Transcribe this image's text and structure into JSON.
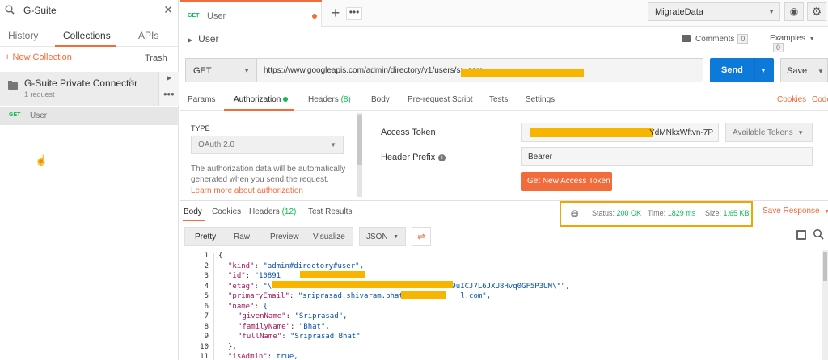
{
  "sidebar": {
    "search_value": "G-Suite",
    "tabs": [
      "History",
      "Collections",
      "APIs"
    ],
    "new_collection": "+ New Collection",
    "trash": "Trash",
    "collection": {
      "name": "G-Suite Private Connector",
      "count": "1 request"
    },
    "request": {
      "method": "GET",
      "name": "User"
    }
  },
  "tabbar": {
    "tab_method": "GET",
    "tab_name": "User",
    "plus": "+",
    "more": "•••",
    "environment": "MigrateData"
  },
  "request": {
    "title": "User",
    "comments_label": "Comments",
    "comments_count": "0",
    "examples_label": "Examples",
    "examples_count": "0",
    "method": "GET",
    "url": "https://www.googleapis.com/admin/directory/v1/users/sr                                          .com",
    "send": "Send",
    "save": "Save"
  },
  "req_tabs": {
    "params": "Params",
    "authorization": "Authorization",
    "headers": "Headers",
    "headers_count": "(8)",
    "body": "Body",
    "prerequest": "Pre-request Script",
    "tests": "Tests",
    "settings": "Settings",
    "cookies": "Cookies",
    "code": "Code"
  },
  "auth": {
    "type_label": "TYPE",
    "type_value": "OAuth 2.0",
    "description": "The authorization data will be automatically generated when you send the request.",
    "learn_more": "Learn more about authorization",
    "access_token_label": "Access Token",
    "access_token_value": "YdMNkxWftvn-7P",
    "available_tokens": "Available Tokens",
    "header_prefix_label": "Header Prefix",
    "header_prefix_value": "Bearer",
    "get_new_token": "Get New Access Token"
  },
  "response": {
    "tabs": {
      "body": "Body",
      "cookies": "Cookies",
      "headers": "Headers",
      "headers_count": "(12)",
      "test_results": "Test Results"
    },
    "status_label": "Status:",
    "status_value": "200 OK",
    "time_label": "Time:",
    "time_value": "1829 ms",
    "size_label": "Size:",
    "size_value": "1.65 KB",
    "save_response": "Save Response",
    "view_modes": [
      "Pretty",
      "Raw",
      "Preview",
      "Visualize"
    ],
    "format": "JSON"
  },
  "code_lines": [
    {
      "n": "1",
      "k": "",
      "v": "{"
    },
    {
      "n": "2",
      "k": "\"kind\"",
      "v": "\"admin#directory#user\","
    },
    {
      "n": "3",
      "k": "\"id\"",
      "v": "\"10891                \","
    },
    {
      "n": "4",
      "k": "\"etag\"",
      "v": "\"\\\"                                     vmM9uICJ7L6JXU8Hvq0GF5P3UM\\\"\","
    },
    {
      "n": "5",
      "k": "\"primaryEmail\"",
      "v": "\"sriprasad.shivaram.bhat@s           l.com\","
    },
    {
      "n": "6",
      "k": "\"name\"",
      "v": "{"
    },
    {
      "n": "7",
      "k": "\"givenName\"",
      "v": "\"Sriprasad\","
    },
    {
      "n": "8",
      "k": "\"familyName\"",
      "v": "\"Bhat\","
    },
    {
      "n": "9",
      "k": "\"fullName\"",
      "v": "\"Sriprasad Bhat\""
    },
    {
      "n": "10",
      "k": "",
      "v": "},"
    },
    {
      "n": "11",
      "k": "\"isAdmin\"",
      "v": "true,"
    }
  ],
  "colors": {
    "accent": "#f26b3a",
    "send_blue": "#0d7ad9",
    "green": "#0cbb52",
    "redaction": "#f7b500",
    "highlight_box": "#f0a500"
  }
}
